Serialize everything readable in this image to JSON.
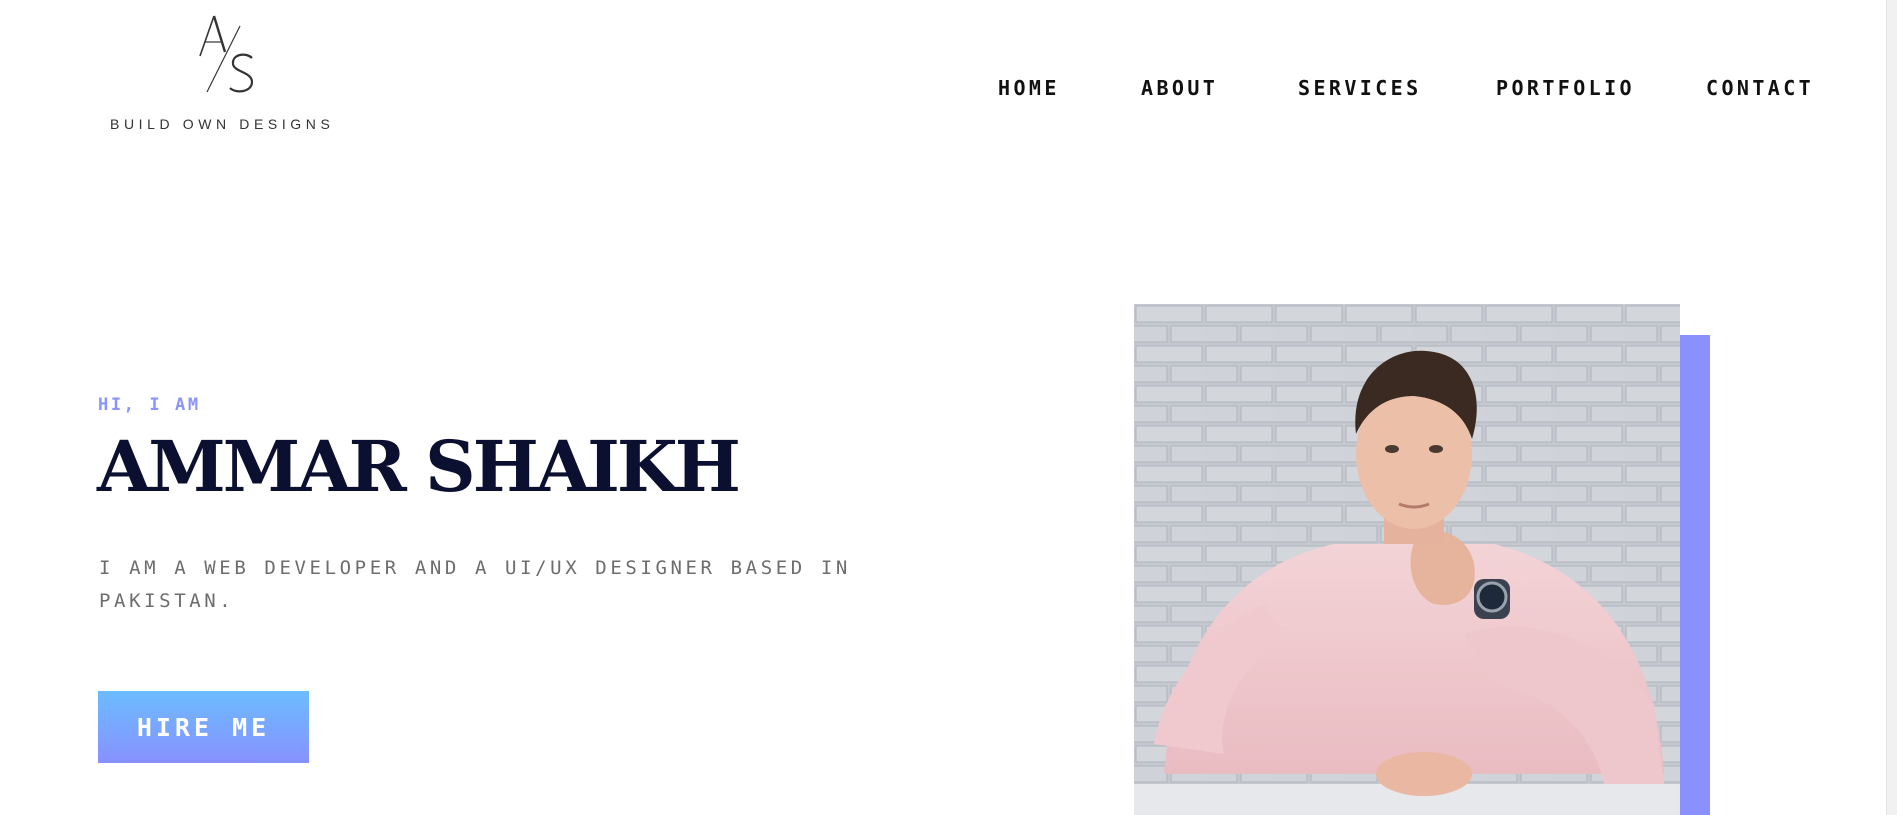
{
  "logo": {
    "mark_text": "A/S",
    "tagline": "BUILD OWN DESIGNS"
  },
  "nav": {
    "items": [
      {
        "label": "HOME"
      },
      {
        "label": "ABOUT"
      },
      {
        "label": "SERVICES"
      },
      {
        "label": "PORTFOLIO"
      },
      {
        "label": "CONTACT"
      }
    ]
  },
  "hero": {
    "greeting": "HI, I AM",
    "name": "AMMAR SHAIKH",
    "intro": "I AM A WEB DEVELOPER AND A UI/UX DESIGNER BASED IN PAKISTAN.",
    "cta_label": "HIRE ME"
  },
  "colors": {
    "accent": "#8a91ff",
    "name": "#0b1030",
    "button_top": "#6cbcff",
    "button_bottom": "#8791ff"
  },
  "icons": [
    "logo-monogram",
    "portrait-photo"
  ]
}
